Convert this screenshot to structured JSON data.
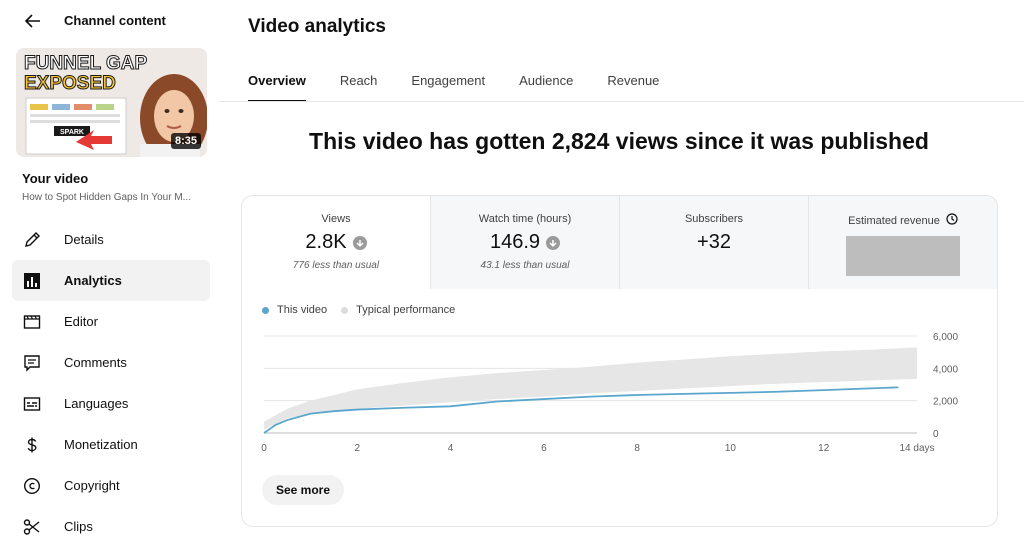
{
  "sidebar": {
    "header_title": "Channel content",
    "thumbnail": {
      "line1": "FUNNEL GAP",
      "line2": "EXPOSED",
      "tag": "SPARK",
      "duration": "8:35"
    },
    "your_video_label": "Your video",
    "video_title": "How to Spot Hidden Gaps In Your M...",
    "items": [
      {
        "label": "Details",
        "icon": "pencil-icon"
      },
      {
        "label": "Analytics",
        "icon": "analytics-icon",
        "active": true
      },
      {
        "label": "Editor",
        "icon": "film-icon"
      },
      {
        "label": "Comments",
        "icon": "comment-icon"
      },
      {
        "label": "Languages",
        "icon": "subtitles-icon"
      },
      {
        "label": "Monetization",
        "icon": "dollar-icon"
      },
      {
        "label": "Copyright",
        "icon": "copyright-icon"
      },
      {
        "label": "Clips",
        "icon": "scissors-icon"
      }
    ]
  },
  "main": {
    "title": "Video analytics",
    "tabs": [
      "Overview",
      "Reach",
      "Engagement",
      "Audience",
      "Revenue"
    ],
    "active_tab": "Overview",
    "headline": "This video has gotten 2,824 views since it was published",
    "metrics": [
      {
        "label": "Views",
        "value": "2.8K",
        "sub": "776 less than usual"
      },
      {
        "label": "Watch time (hours)",
        "value": "146.9",
        "sub": "43.1 less than usual"
      },
      {
        "label": "Subscribers",
        "value": "+32",
        "sub": ""
      },
      {
        "label": "Estimated revenue",
        "value": "",
        "sub": ""
      }
    ],
    "see_more": "See more"
  },
  "colors": {
    "this_video": "#5aa6cc",
    "typical": "#e6e6e6",
    "active_tab": "#0f0f0f"
  },
  "chart_data": {
    "type": "area",
    "legend": [
      "This video",
      "Typical performance"
    ],
    "x_ticks": [
      "0",
      "2",
      "4",
      "6",
      "8",
      "10",
      "12",
      "14 days"
    ],
    "y_ticks": [
      "6,000",
      "4,000",
      "2,000",
      "0"
    ],
    "ylim": [
      0,
      6000
    ],
    "xlim": [
      0,
      14
    ],
    "series": [
      {
        "name": "This video",
        "x": [
          0,
          0.25,
          0.5,
          1,
          1.5,
          2,
          3,
          4,
          5,
          6,
          7,
          8,
          9,
          10,
          11,
          12,
          13,
          13.6
        ],
        "values": [
          0,
          500,
          800,
          1200,
          1350,
          1450,
          1560,
          1650,
          1950,
          2100,
          2250,
          2350,
          2420,
          2480,
          2550,
          2650,
          2760,
          2824
        ]
      },
      {
        "name": "Typical performance",
        "x": [
          0,
          0.5,
          1,
          2,
          3,
          4,
          5,
          6,
          7,
          8,
          9,
          10,
          11,
          12,
          13,
          14
        ],
        "low": [
          200,
          900,
          1200,
          1500,
          1700,
          1900,
          2100,
          2250,
          2450,
          2600,
          2750,
          2900,
          3050,
          3150,
          3250,
          3350
        ],
        "high": [
          700,
          1500,
          2000,
          2700,
          3100,
          3450,
          3700,
          3900,
          4100,
          4350,
          4550,
          4750,
          4900,
          5050,
          5150,
          5300
        ]
      }
    ],
    "grid": true
  }
}
